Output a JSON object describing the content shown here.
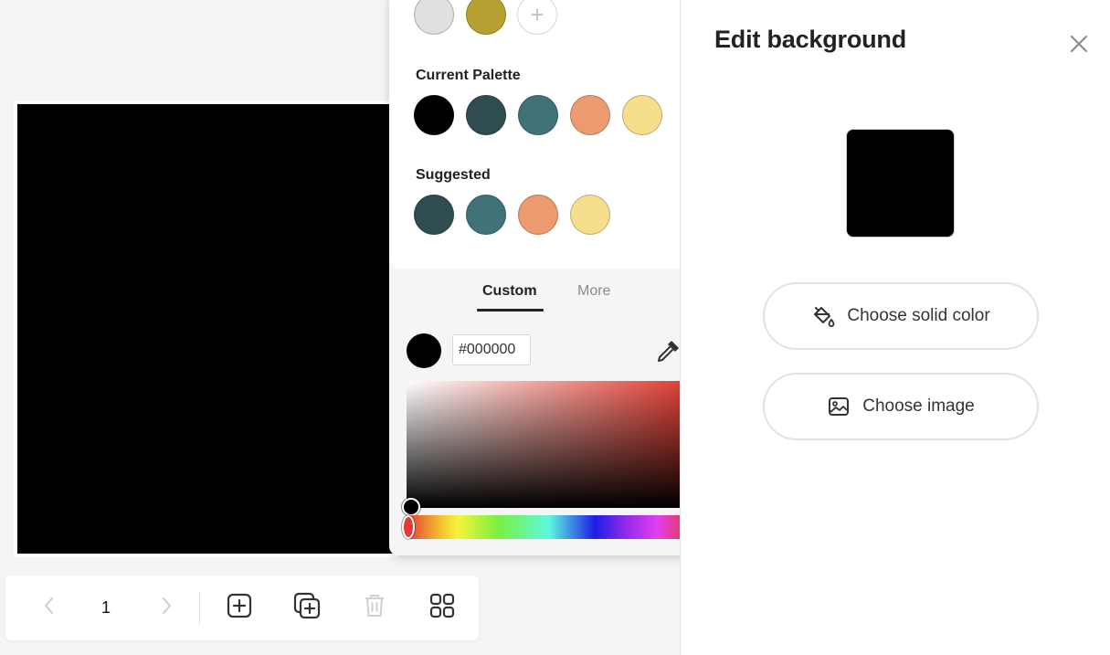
{
  "colors": {
    "canvas_bg": "#000000",
    "accent_text": "#222222"
  },
  "recent_colors": [
    {
      "hex": "#e0e0e0"
    },
    {
      "hex": "#b7a032"
    }
  ],
  "add_swatch_glyph": "+",
  "current_palette": {
    "label": "Current Palette",
    "swatches": [
      "#000000",
      "#2f4d50",
      "#41727a",
      "#ec9a70",
      "#f5de8c"
    ]
  },
  "suggested": {
    "label": "Suggested",
    "swatches": [
      "#2f4d50",
      "#41727a",
      "#ec9a70",
      "#f5de8c"
    ]
  },
  "tabs": [
    {
      "label": "Custom",
      "active": true
    },
    {
      "label": "More",
      "active": false
    }
  ],
  "custom": {
    "hex_value": "#000000",
    "selected_color": "#000000",
    "hue_color": "#e03a2e"
  },
  "page_nav": {
    "current_page": "1"
  },
  "right_panel": {
    "title": "Edit background",
    "preview_color": "#000000",
    "buttons": {
      "solid_color": "Choose solid color",
      "image": "Choose image"
    }
  },
  "icons": {
    "prev": "chevron-left-icon",
    "next": "chevron-right-icon",
    "add_page": "add-page-icon",
    "duplicate_page": "duplicate-page-icon",
    "delete_page": "trash-icon",
    "grid_view": "grid-icon",
    "eyedropper": "eyedropper-icon",
    "close": "close-icon",
    "paint_bucket": "paint-bucket-icon",
    "image": "image-icon"
  }
}
